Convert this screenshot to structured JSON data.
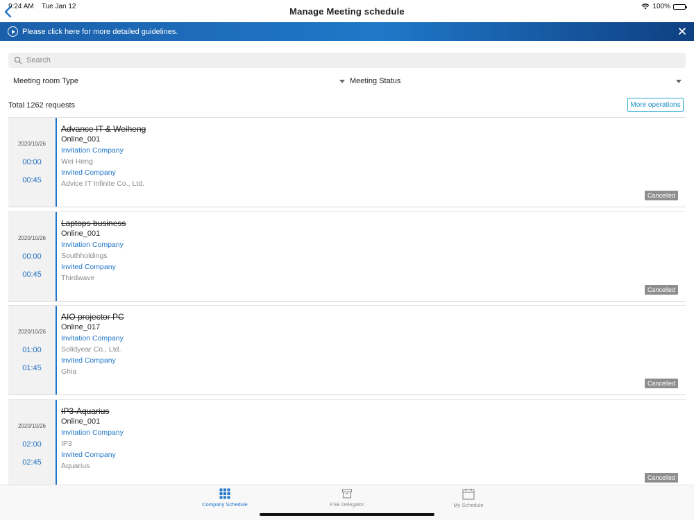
{
  "status_bar": {
    "time": "9:24 AM",
    "date": "Tue Jan 12",
    "battery": "100%"
  },
  "nav": {
    "title": "Manage Meeting schedule"
  },
  "banner": {
    "text": "Please click here for more detailed guidelines."
  },
  "search": {
    "placeholder": "Search"
  },
  "filters": {
    "room_type": "Meeting room Type",
    "status": "Meeting Status"
  },
  "summary": {
    "total": "Total 1262 requests",
    "more_ops": "More operations"
  },
  "labels": {
    "invitation": "Invitation Company",
    "invited": "Invited Company"
  },
  "meetings": [
    {
      "name": "Advance IT & Weiheng",
      "room": "Online_001",
      "date": "2020/10/26",
      "start": "00:00",
      "end": "00:45",
      "inviting": "Wei Heng",
      "invited": "Advice IT Infinite Co., Ltd.",
      "status": "Cancelled"
    },
    {
      "name": "Laptops business",
      "room": "Online_001",
      "date": "2020/10/26",
      "start": "00:00",
      "end": "00:45",
      "inviting": "Southholdings",
      "invited": "Thirdwave",
      "status": "Cancelled"
    },
    {
      "name": "AIO projector PC",
      "room": "Online_017",
      "date": "2020/10/26",
      "start": "01:00",
      "end": "01:45",
      "inviting": "Solidyear Co., Ltd.",
      "invited": "Ghia",
      "status": "Cancelled"
    },
    {
      "name": "IP3-Aquarius",
      "room": "Online_001",
      "date": "2020/10/26",
      "start": "02:00",
      "end": "02:45",
      "inviting": "IP3",
      "invited": "Aquarius",
      "status": "Cancelled"
    }
  ],
  "tabs": [
    {
      "label": "Company Schedule",
      "icon": "grid-icon",
      "active": true
    },
    {
      "label": "FSE Delegator",
      "icon": "archive-box-icon",
      "active": false
    },
    {
      "label": "My Schedule",
      "icon": "calendar-icon",
      "active": false
    }
  ],
  "colors": {
    "accent": "#1f75c8",
    "banner": "#1f78c8",
    "badge": "#8e8e8e",
    "outline_button": "#29a8d8"
  }
}
